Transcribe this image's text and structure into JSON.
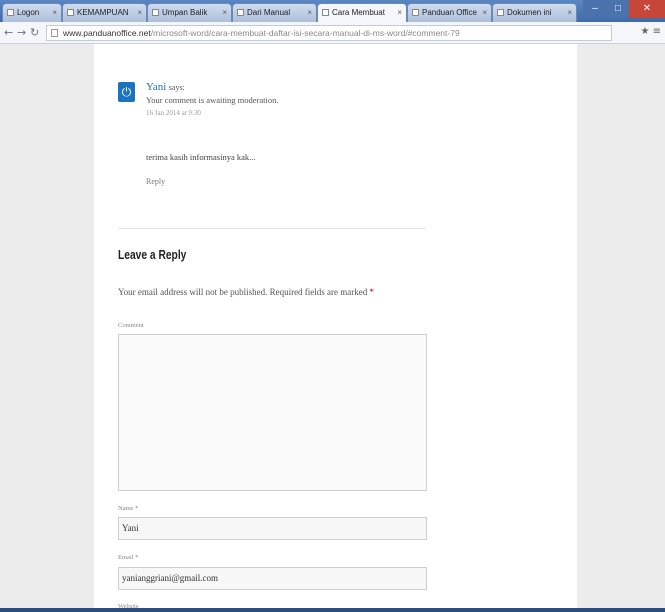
{
  "browser": {
    "tabs": [
      {
        "label": "Logon",
        "active": false
      },
      {
        "label": "KEMAMPUAN",
        "active": false
      },
      {
        "label": "Umpan Balik",
        "active": false
      },
      {
        "label": "Dari Manual",
        "active": false
      },
      {
        "label": "Cara Membuat",
        "active": true
      },
      {
        "label": "Panduan Office",
        "active": false
      },
      {
        "label": "Dokumen ini",
        "active": false
      }
    ],
    "address": {
      "host": "www.panduanoffice.net",
      "path": "/microsoft-word/cara-membuat-daftar-isi-secara-manual-di-ms-word/#comment-79"
    }
  },
  "comment": {
    "author": "Yani",
    "says": "says:",
    "moderation": "Your comment is awaiting moderation.",
    "date": "16 Jan 2014 at 9:30",
    "text": "terima kasih informasinya kak...",
    "reply_label": "Reply"
  },
  "reply_form": {
    "title": "Leave a Reply",
    "notes": "Your email address will not be published. Required fields are marked",
    "required_mark": "*",
    "comment_label": "Comment",
    "name_label": "Name *",
    "name_value": "Yani",
    "email_label": "Email *",
    "email_value": "yanianggriani@gmail.com",
    "website_label": "Website"
  },
  "colors": {
    "link": "#21759b",
    "avatar": "#1e73be",
    "tabbar": "#3f6aa8"
  }
}
